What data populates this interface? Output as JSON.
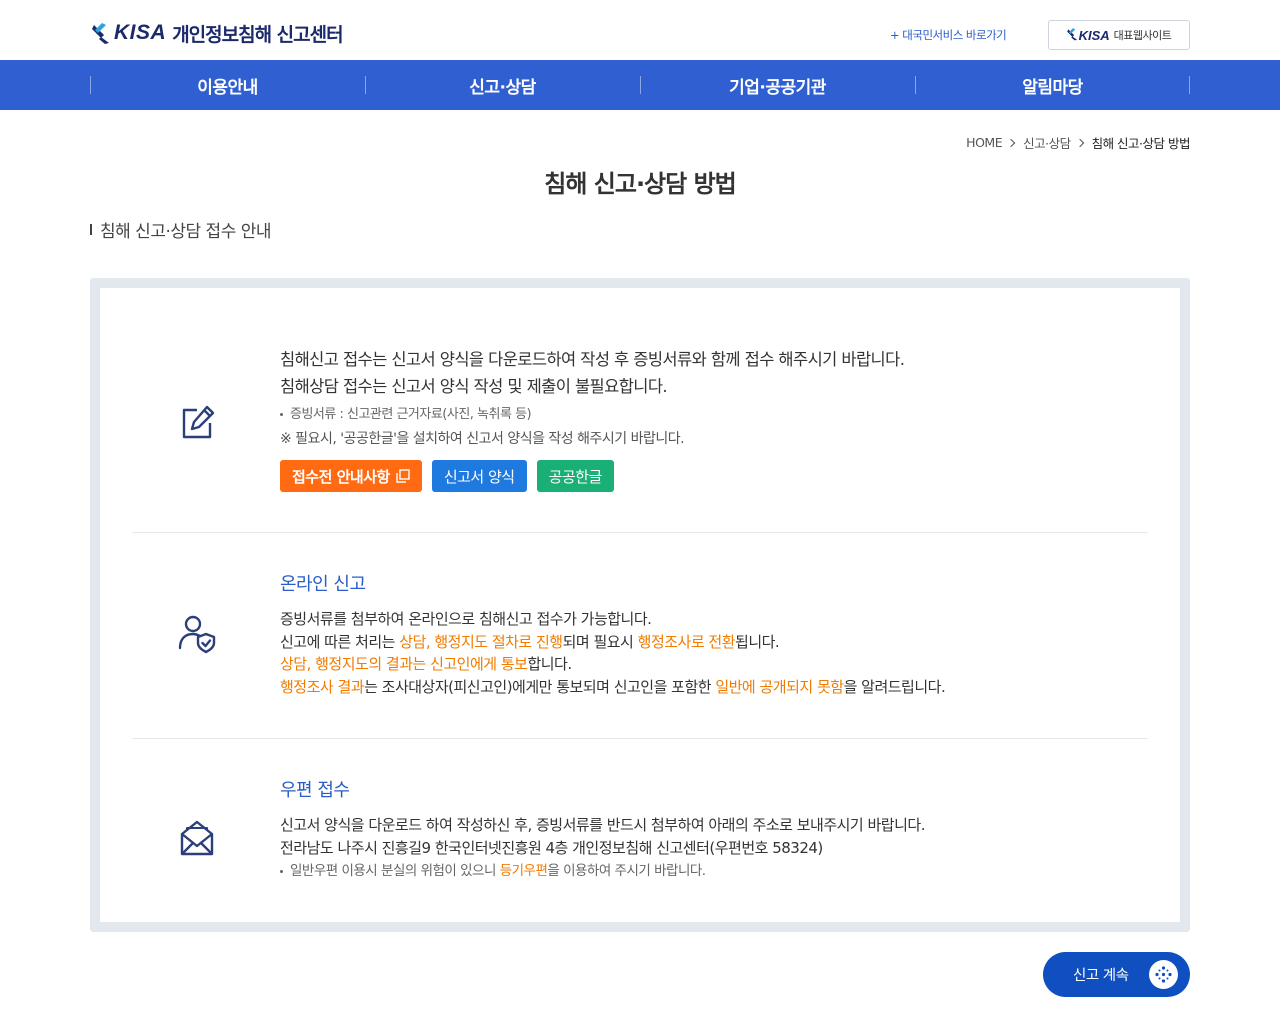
{
  "header": {
    "logo_brand": "KISA",
    "logo_title": "개인정보침해 신고센터",
    "gov_link": "+ 대국민서비스 바로가기",
    "site_button_brand": "KISA",
    "site_button_label": "대표웹사이트"
  },
  "nav": {
    "items": [
      {
        "label": "이용안내"
      },
      {
        "label": "신고·상담"
      },
      {
        "label": "기업·공공기관"
      },
      {
        "label": "알림마당"
      }
    ]
  },
  "breadcrumb": {
    "home": "HOME",
    "level1": "신고·상담",
    "current": "침해 신고·상담 방법"
  },
  "page_title": "침해 신고·상담 방법",
  "section_title": "침해 신고·상담 접수 안내",
  "block1": {
    "icon": "edit-icon",
    "line1": "침해신고 접수는 신고서 양식을 다운로드하여 작성 후 증빙서류와 함께 접수 해주시기 바랍니다.",
    "line2": "침해상담 접수는 신고서 양식 작성 및 제출이 불필요합니다.",
    "note1": "증빙서류 : 신고관련 근거자료(사진, 녹취록 등)",
    "note2": "※ 필요시, '공공한글'을 설치하여 신고서 양식을 작성 해주시기 바랍니다.",
    "buttons": {
      "guide": "접수전 안내사항",
      "form": "신고서 양식",
      "hangul": "공공한글"
    },
    "colors": {
      "guide": "#ff6a13",
      "form": "#1f7ae0",
      "hangul": "#1aaf74"
    }
  },
  "block2": {
    "icon": "user-shield-icon",
    "heading": "온라인 신고",
    "line1": "증빙서류를 첨부하여 온라인으로 침해신고 접수가 가능합니다.",
    "line2": {
      "a": "신고에 따른 처리는 ",
      "b": "상담, 행정지도 절차로 진행",
      "c": "되며 필요시 ",
      "d": "행정조사로 전환",
      "e": "됩니다."
    },
    "line3": {
      "a": "상담, 행정지도의 결과는 신고인에게 통보",
      "b": "합니다."
    },
    "line4": {
      "a": "행정조사 결과",
      "b": "는 조사대상자(피신고인)에게만 통보되며 신고인을 포함한 ",
      "c": "일반에 공개되지 못함",
      "d": "을 알려드립니다."
    }
  },
  "block3": {
    "icon": "mail-icon",
    "heading": "우편 접수",
    "line1": "신고서 양식을 다운로드 하여 작성하신 후, 증빙서류를 반드시 첨부하여 아래의 주소로 보내주시기 바랍니다.",
    "line2": "전라남도 나주시 진흥길9 한국인터넷진흥원 4층 개인정보침해 신고센터(우편번호 58324)",
    "note": {
      "a": "일반우편 이용시 분실의 위험이 있으니 ",
      "b": "등기우편",
      "c": "을 이용하여 주시기 바랍니다."
    }
  },
  "continue_button": "신고 계속",
  "theme": {
    "primary": "#2f5fd0",
    "accent_orange": "#f27b00",
    "link_blue": "#2a5dc9"
  }
}
